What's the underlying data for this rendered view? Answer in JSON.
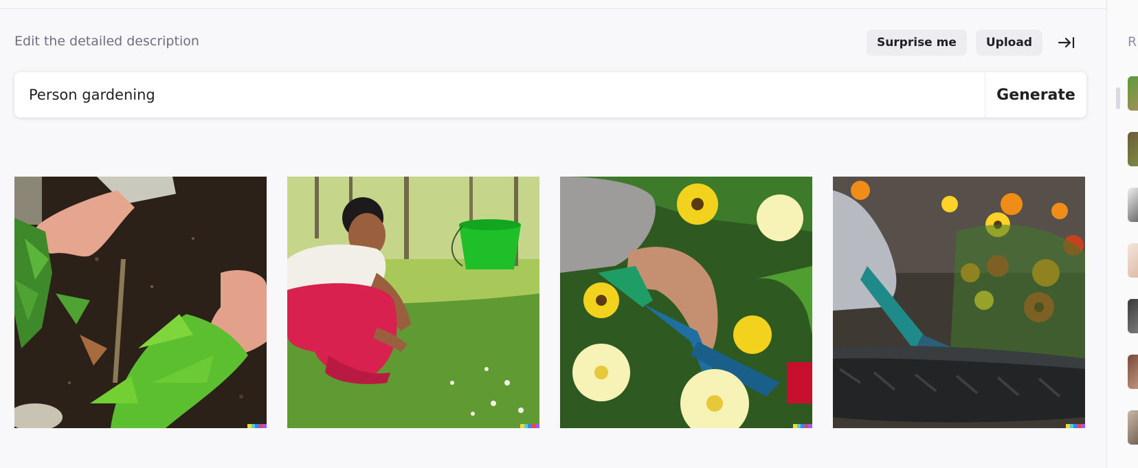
{
  "header": {
    "label": "Edit the detailed description",
    "surprise_label": "Surprise me",
    "upload_label": "Upload",
    "collapse_icon": "collapse-right-icon"
  },
  "prompt": {
    "value": "Person gardening",
    "generate_label": "Generate"
  },
  "images": [
    {
      "name": "result-image-1",
      "subject": "hands planting seedlings in soil"
    },
    {
      "name": "result-image-2",
      "subject": "woman crouching in garden with green bucket"
    },
    {
      "name": "result-image-3",
      "subject": "hand with trowel among yellow flowers"
    },
    {
      "name": "result-image-4",
      "subject": "gloved hand with trowel in flower pot"
    }
  ],
  "sidebar": {
    "title": "R",
    "thumbnail_count": 7
  },
  "colors": {
    "background": "#f8f8fa",
    "button_bg": "#ececf1",
    "text": "#202123",
    "muted": "#6e6e80",
    "signature": [
      "#f7d33f",
      "#4fd1c5",
      "#3b82f6",
      "#ef4444",
      "#a855f7"
    ]
  }
}
